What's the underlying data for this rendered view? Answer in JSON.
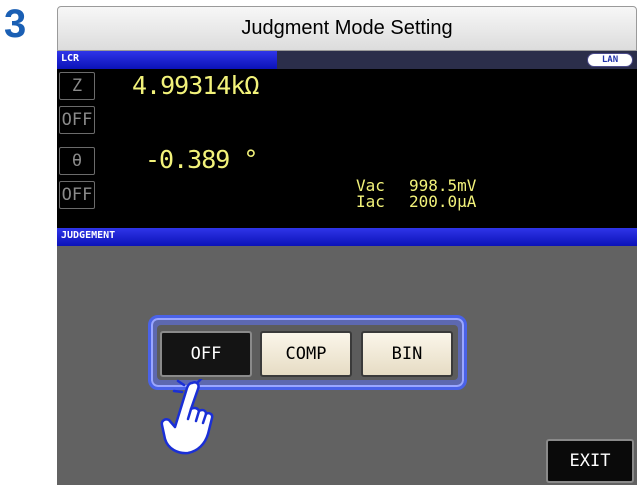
{
  "step": "3",
  "title": "Judgment Mode Setting",
  "lcr_bar": {
    "label": "LCR",
    "lan_badge": "LAN"
  },
  "measurements": [
    {
      "param": "Z",
      "value": "4.99314kΩ"
    },
    {
      "param": "OFF",
      "value": ""
    },
    {
      "param": "θ",
      "value": "-0.389 °"
    },
    {
      "param": "OFF",
      "value": ""
    }
  ],
  "monitor": {
    "vac_label": "Vac",
    "vac_value": "998.5mV",
    "iac_label": "Iac",
    "iac_value": "200.0μA"
  },
  "judgement_bar": {
    "label": "JUDGEMENT"
  },
  "modes": [
    {
      "label": "OFF",
      "selected": true
    },
    {
      "label": "COMP",
      "selected": false
    },
    {
      "label": "BIN",
      "selected": false
    }
  ],
  "exit_label": "EXIT",
  "colors": {
    "step_number": "#1a5fb4",
    "section_bar": "#1a1fd0",
    "value_text": "#f2f27a",
    "panel_bg": "#626262",
    "highlight": "#4a62e8"
  }
}
